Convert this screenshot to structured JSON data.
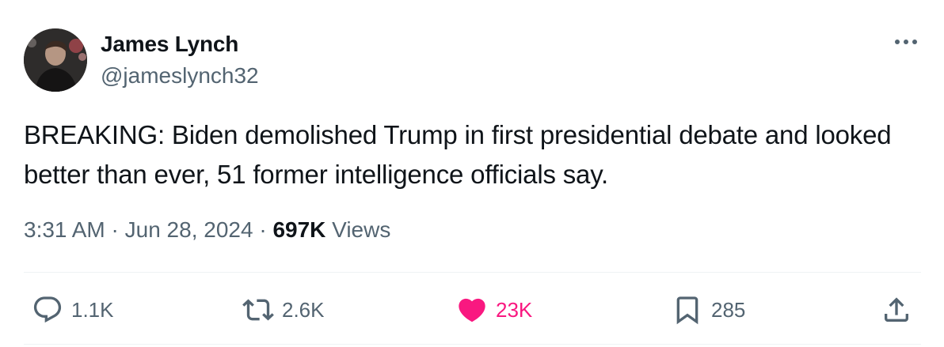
{
  "author": {
    "display_name": "James Lynch",
    "handle": "@jameslynch32"
  },
  "tweet": {
    "text": "BREAKING: Biden demolished Trump in first presidential debate and looked better than ever, 51 former intelligence officials say.",
    "time": "3:31 AM",
    "date": "Jun 28, 2024",
    "separator": "·",
    "views_count": "697K",
    "views_label": "Views"
  },
  "actions": {
    "replies": "1.1K",
    "reposts": "2.6K",
    "likes": "23K",
    "bookmarks": "285"
  },
  "icons": {
    "more": "more-horizontal-icon",
    "reply": "reply-bubble-icon",
    "repost": "repost-arrows-icon",
    "like": "heart-filled-icon",
    "bookmark": "bookmark-icon",
    "share": "share-upload-icon"
  },
  "colors": {
    "text_primary": "#0f1419",
    "text_secondary": "#536471",
    "like_active": "#f91880",
    "divider": "#eff3f4"
  }
}
